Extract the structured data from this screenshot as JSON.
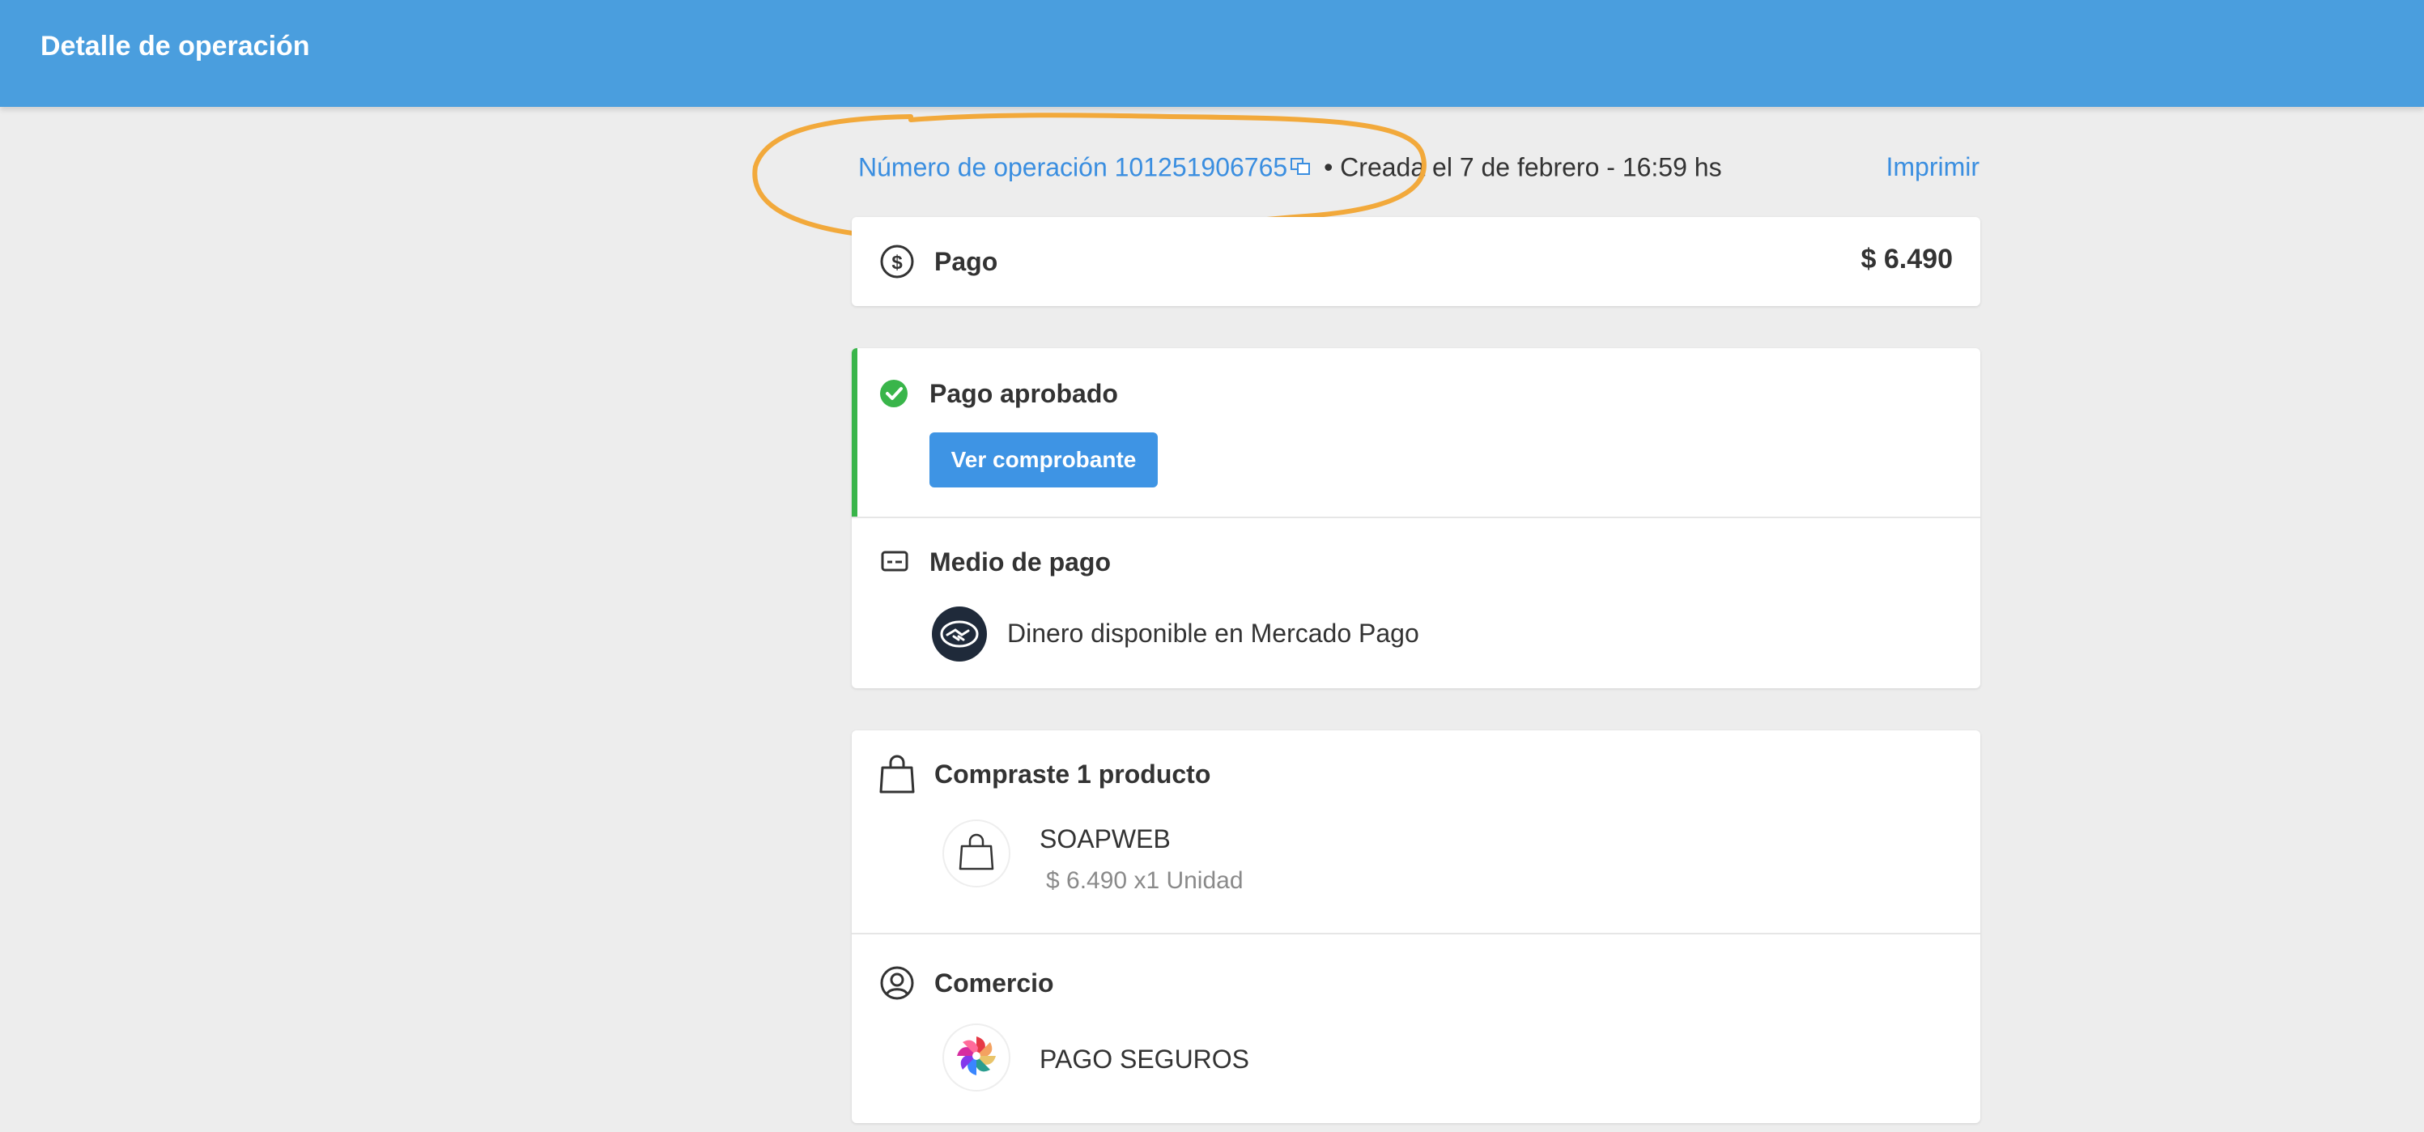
{
  "header": {
    "title": "Detalle de operación"
  },
  "operation": {
    "number_label": "Número de operación 101251906765",
    "created": " • Creada el 7 de febrero - 16:59 hs",
    "print_label": "Imprimir"
  },
  "payment": {
    "label": "Pago",
    "amount": "$ 6.490"
  },
  "status": {
    "title": "Pago aprobado",
    "voucher_button": "Ver comprobante",
    "accent_color": "#39b54a"
  },
  "payment_method": {
    "title": "Medio de pago",
    "method": "Dinero disponible en Mercado Pago"
  },
  "products": {
    "title": "Compraste 1 producto",
    "items": [
      {
        "name": "SOAPWEB",
        "price": "$ 6.490",
        "quantity": "x1 Unidad"
      }
    ]
  },
  "merchant": {
    "title": "Comercio",
    "name": "PAGO SEGUROS"
  },
  "colors": {
    "brand_blue": "#4a9ede",
    "link_blue": "#3a8ee0",
    "annotation": "#f2a93b"
  }
}
